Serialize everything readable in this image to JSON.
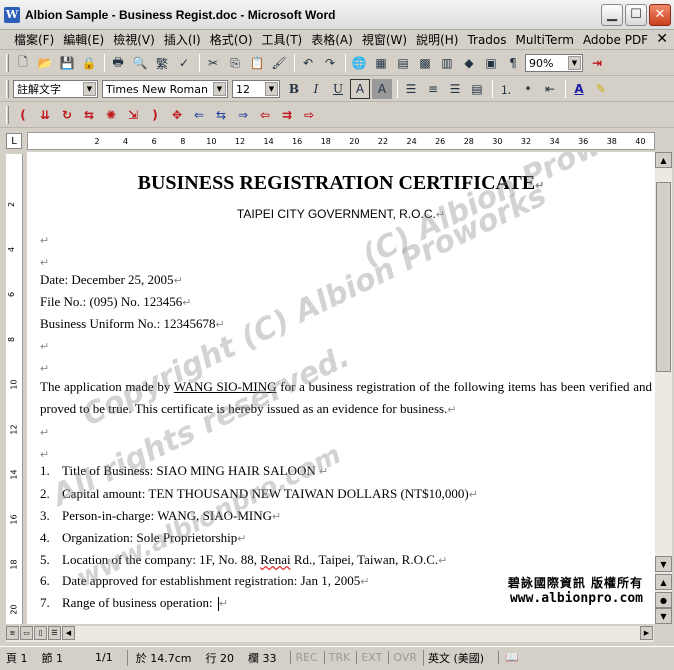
{
  "window": {
    "title": "Albion Sample - Business Regist.doc - Microsoft Word",
    "app_icon": "W"
  },
  "menu": [
    "檔案(F)",
    "編輯(E)",
    "檢視(V)",
    "插入(I)",
    "格式(O)",
    "工具(T)",
    "表格(A)",
    "視窗(W)",
    "說明(H)",
    "Trados",
    "MultiTerm",
    "Adobe PDF"
  ],
  "toolbar": {
    "zoom": "90%",
    "style": "註解文字",
    "font": "Times New Roman",
    "font_size": "12",
    "bold": "B",
    "italic": "I",
    "underline": "U",
    "char_box": "A",
    "char_shade": "A"
  },
  "ruler": {
    "ticks": [
      "2",
      "4",
      "6",
      "8",
      "10",
      "12",
      "14",
      "16",
      "18",
      "20",
      "22",
      "24",
      "26",
      "28",
      "30",
      "32",
      "34",
      "36",
      "38",
      "40",
      "42"
    ],
    "vticks": [
      "2",
      "4",
      "6",
      "8",
      "10",
      "12",
      "14",
      "16",
      "18",
      "20"
    ]
  },
  "document": {
    "title": "BUSINESS REGISTRATION CERTIFICATE",
    "subtitle": "TAIPEI CITY GOVERNMENT, R.O.C.",
    "date": "Date: December 25, 2005",
    "file_no": "File No.: (095) No. 123456",
    "uniform_no": "Business Uniform No.: 12345678",
    "para_a": "The application made by ",
    "applicant": "WANG SIO-MING",
    "para_b": " for a business registration of the following items has been verified and proved to be true. This certificate is hereby issued as an evidence for business.",
    "items": [
      {
        "num": "1.",
        "text": "Title of Business: SIAO MING HAIR SALOON"
      },
      {
        "num": "2.",
        "text": "Capital amount: TEN THOUSAND NEW TAIWAN DOLLARS (NT$10,000)"
      },
      {
        "num": "3.",
        "text": "Person-in-charge: WANG, SIAO-MING"
      },
      {
        "num": "4.",
        "text": "Organization: Sole Proprietorship"
      },
      {
        "num": "5.",
        "text_a": "Location of the company: 1F, No. 88, ",
        "text_b": "Renai",
        "text_c": " Rd., Taipei, Taiwan, R.O.C."
      },
      {
        "num": "6.",
        "text": "Date approved for establishment registration: Jan 1, 2005"
      },
      {
        "num": "7.",
        "text": "Range of business operation: "
      }
    ],
    "para_mark": "↵"
  },
  "watermark": {
    "lines": [
      "(C) Albion Proworks",
      "Copyright (C) Albion Proworks",
      "All rights reserved.",
      "www.albionpro.com"
    ]
  },
  "stamp": {
    "chinese": "碧詠國際資訊 版權所有",
    "website": "www.albionpro.com"
  },
  "status": {
    "page": "頁 1",
    "section": "節 1",
    "pages": "1/1",
    "at": "於 14.7cm",
    "line": "行 20",
    "col": "欄 33",
    "rec": "REC",
    "trk": "TRK",
    "ext": "EXT",
    "ovr": "OVR",
    "lang": "英文 (美國)"
  }
}
